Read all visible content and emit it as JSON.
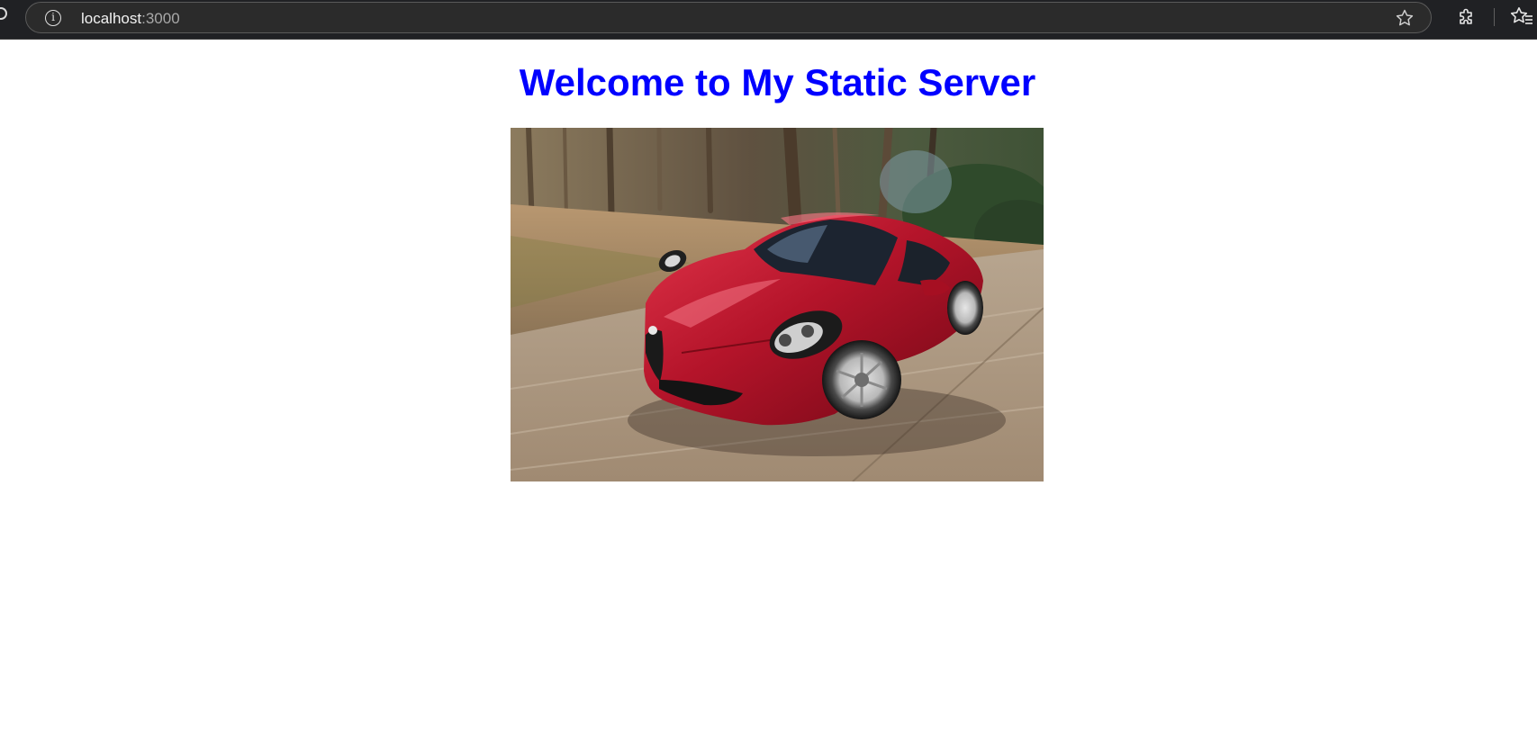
{
  "browser": {
    "url_host": "localhost",
    "url_port": ":3000",
    "icons": {
      "site_info": "info-icon",
      "bookmark": "star-icon",
      "extensions": "puzzle-icon",
      "favorites": "favorites-icon"
    }
  },
  "page": {
    "heading": "Welcome to My Static Server",
    "heading_color": "#0000ff",
    "image": {
      "subject": "red sports car driving on a road through a forest"
    }
  }
}
